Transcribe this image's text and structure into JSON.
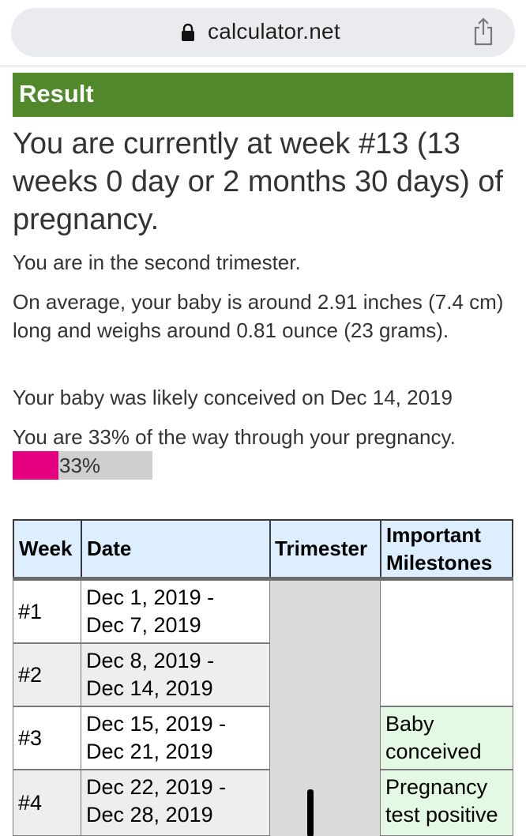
{
  "browser": {
    "url": "calculator.net"
  },
  "result": {
    "header": "Result",
    "headline": "You are currently at week #13 (13 weeks 0 day or 2 months 30 days) of pregnancy.",
    "trimester_text": "You are in the second trimester.",
    "average_text": "On average, your baby is around 2.91 inches (7.4 cm) long and weighs around 0.81 ounce (23 grams).",
    "conceived_text": "Your baby was likely conceived on Dec 14, 2019",
    "progress_text": "You are 33% of the way through your pregnancy.",
    "progress_label": "33%",
    "progress_fraction": 0.33,
    "progress_color": "#e4007f"
  },
  "table": {
    "headers": {
      "week": "Week",
      "date": "Date",
      "trimester": "Trimester",
      "milestones_line1": "Important",
      "milestones_line2": "Milestones"
    },
    "rows": [
      {
        "week": "#1",
        "date_line1": "Dec 1, 2019 -",
        "date_line2": "Dec 7, 2019",
        "milestone_line1": "",
        "milestone_line2": ""
      },
      {
        "week": "#2",
        "date_line1": "Dec 8, 2019 -",
        "date_line2": "Dec 14, 2019",
        "milestone_line1": "",
        "milestone_line2": ""
      },
      {
        "week": "#3",
        "date_line1": "Dec 15, 2019 -",
        "date_line2": "Dec 21, 2019",
        "milestone_line1": "Baby",
        "milestone_line2": "conceived"
      },
      {
        "week": "#4",
        "date_line1": "Dec 22, 2019 -",
        "date_line2": "Dec 28, 2019",
        "milestone_line1": "Pregnancy",
        "milestone_line2": "test positive"
      }
    ]
  },
  "colors": {
    "result_header_bg": "#51882c",
    "table_header_bg": "#ddeeff",
    "milestone_bg": "#e3f9e3"
  }
}
